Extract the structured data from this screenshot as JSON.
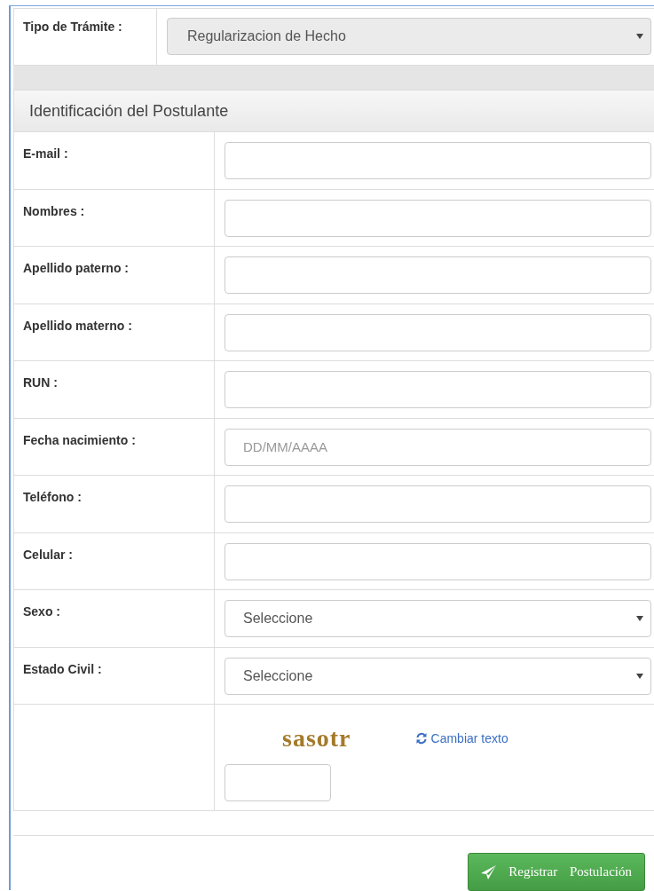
{
  "tramite": {
    "label": "Tipo de Trámite :",
    "value": "Regularizacion de Hecho"
  },
  "panel": {
    "title": "Identificación del Postulante"
  },
  "fields": [
    {
      "kind": "text",
      "label": "E-mail :"
    },
    {
      "kind": "text",
      "label": "Nombres :"
    },
    {
      "kind": "text",
      "label": "Apellido paterno :"
    },
    {
      "kind": "text",
      "label": "Apellido materno :"
    },
    {
      "kind": "text",
      "label": "RUN :"
    },
    {
      "kind": "text",
      "label": "Fecha nacimiento :",
      "placeholder": "DD/MM/AAAA"
    },
    {
      "kind": "text",
      "label": "Teléfono :"
    },
    {
      "kind": "text",
      "label": "Celular :"
    },
    {
      "kind": "select",
      "label": "Sexo :",
      "value": "Seleccione"
    },
    {
      "kind": "select",
      "label": "Estado Civil :",
      "value": "Seleccione"
    }
  ],
  "captcha": {
    "text": "sasotr",
    "refresh_label": "Cambiar texto"
  },
  "submit": {
    "label": "Registrar Postulación"
  }
}
